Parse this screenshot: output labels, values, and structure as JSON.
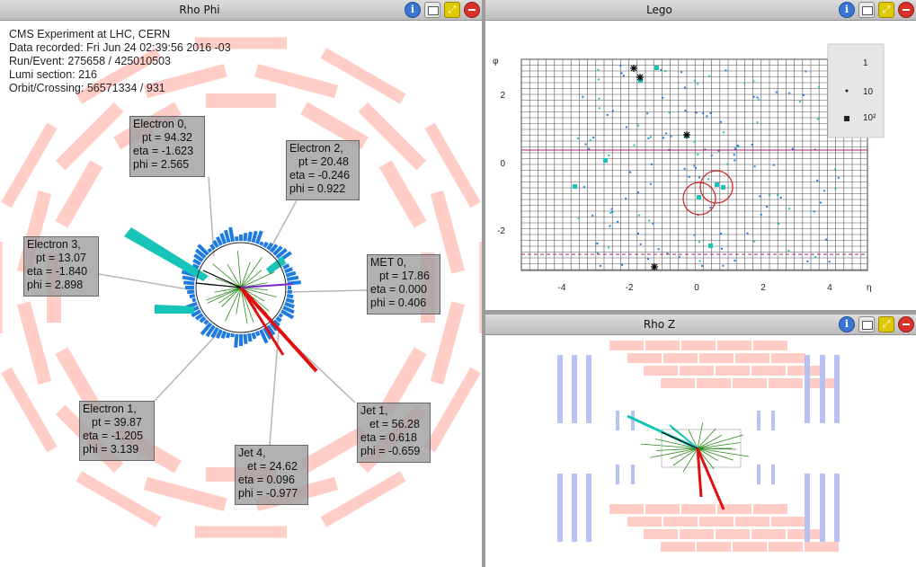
{
  "views": {
    "rhophi": {
      "title": "Rho Phi"
    },
    "lego": {
      "title": "Lego"
    },
    "rhoz": {
      "title": "Rho Z"
    }
  },
  "buttons": {
    "info": "i"
  },
  "event_info": {
    "line1": "CMS Experiment at LHC, CERN",
    "line2": "Data recorded: Fri Jun 24 02:39:56 2016 -03",
    "line3": "Run/Event: 275658 / 425010503",
    "line4": "Lumi section: 216",
    "line5": "Orbit/Crossing: 56571334 / 931"
  },
  "labels": {
    "electron0": {
      "name": "Electron 0,",
      "l1": "pt = 94.32",
      "l2": "eta = -1.623",
      "l3": "phi = 2.565"
    },
    "electron2": {
      "name": "Electron 2,",
      "l1": "pt = 20.48",
      "l2": "eta = -0.246",
      "l3": "phi = 0.922"
    },
    "electron3": {
      "name": "Electron 3,",
      "l1": "pt = 13.07",
      "l2": "eta = -1.840",
      "l3": "phi = 2.898"
    },
    "met0": {
      "name": "MET 0,",
      "l1": "pt = 17.86",
      "l2": "eta = 0.000",
      "l3": "phi = 0.406"
    },
    "electron1": {
      "name": "Electron 1,",
      "l1": "pt = 39.87",
      "l2": "eta = -1.205",
      "l3": "phi = 3.139"
    },
    "jet1": {
      "name": "Jet 1,",
      "l1": "et = 56.28",
      "l2": "eta = 0.618",
      "l3": "phi = -0.659"
    },
    "jet4": {
      "name": "Jet 4,",
      "l1": "et = 24.62",
      "l2": "eta = 0.096",
      "l3": "phi = -0.977"
    }
  },
  "lego": {
    "phi_label": "φ",
    "eta_label": "η",
    "x_ticks": [
      "-4",
      "-2",
      "0",
      "2",
      "4"
    ],
    "y_ticks": [
      "2",
      "0",
      "-2"
    ],
    "legend": [
      "1",
      "10",
      "10²"
    ]
  },
  "colors": {
    "muon_chamber": "#ffcdc6",
    "ecal": "#16c4b8",
    "hcal": "#1e7be0",
    "tracks": "#2a8a1a",
    "jet": "#e01010",
    "rhoz_chamber": "#b8c2f2"
  }
}
